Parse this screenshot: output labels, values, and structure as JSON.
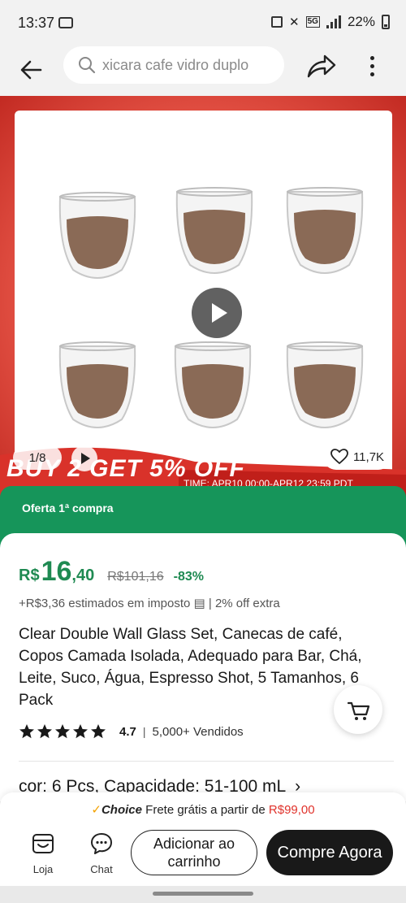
{
  "status_bar": {
    "time": "13:37",
    "battery": "22%",
    "network": "5G"
  },
  "search": {
    "placeholder": "xicara cafe vidro duplo"
  },
  "gallery": {
    "counter": "1/8",
    "likes": "11,7K",
    "promo_text": "BUY 2 GET 5% OFF",
    "promo_time": "TIME: APR10 00:00-APR12 23:59 PDT",
    "background": "#e9584a",
    "coffee_color": "#8a6a56"
  },
  "offer": {
    "label": "Oferta 1ª compra",
    "color": "#16955a"
  },
  "price": {
    "currency": "R$",
    "integer": "16",
    "decimal": ",40",
    "original": "R$101,16",
    "discount": "-83%",
    "color": "#1f8a52"
  },
  "tax": {
    "text": "+R$3,36 estimados em imposto",
    "icon": "receipt-icon",
    "extra": "| 2% off extra"
  },
  "product": {
    "title": "Clear Double Wall Glass Set, Canecas de café, Copos Camada Isolada, Adequado para Bar, Chá, Leite, Suco, Água, Espresso Shot, 5 Tamanhos, 6 Pack"
  },
  "rating": {
    "stars": 5,
    "value": "4.7",
    "separator": "|",
    "sold": "5,000+ Vendidos"
  },
  "variant": {
    "text": "cor: 6 Pcs, Capacidade: 51-100 mL"
  },
  "shipping": {
    "check": "✓",
    "choice": "Choice",
    "text": "Frete grátis a partir de",
    "value": "R$99,00"
  },
  "bottom_nav": {
    "store_label": "Loja",
    "chat_label": "Chat",
    "add_to_cart": "Adicionar ao carrinho",
    "buy_now": "Compre Agora"
  }
}
